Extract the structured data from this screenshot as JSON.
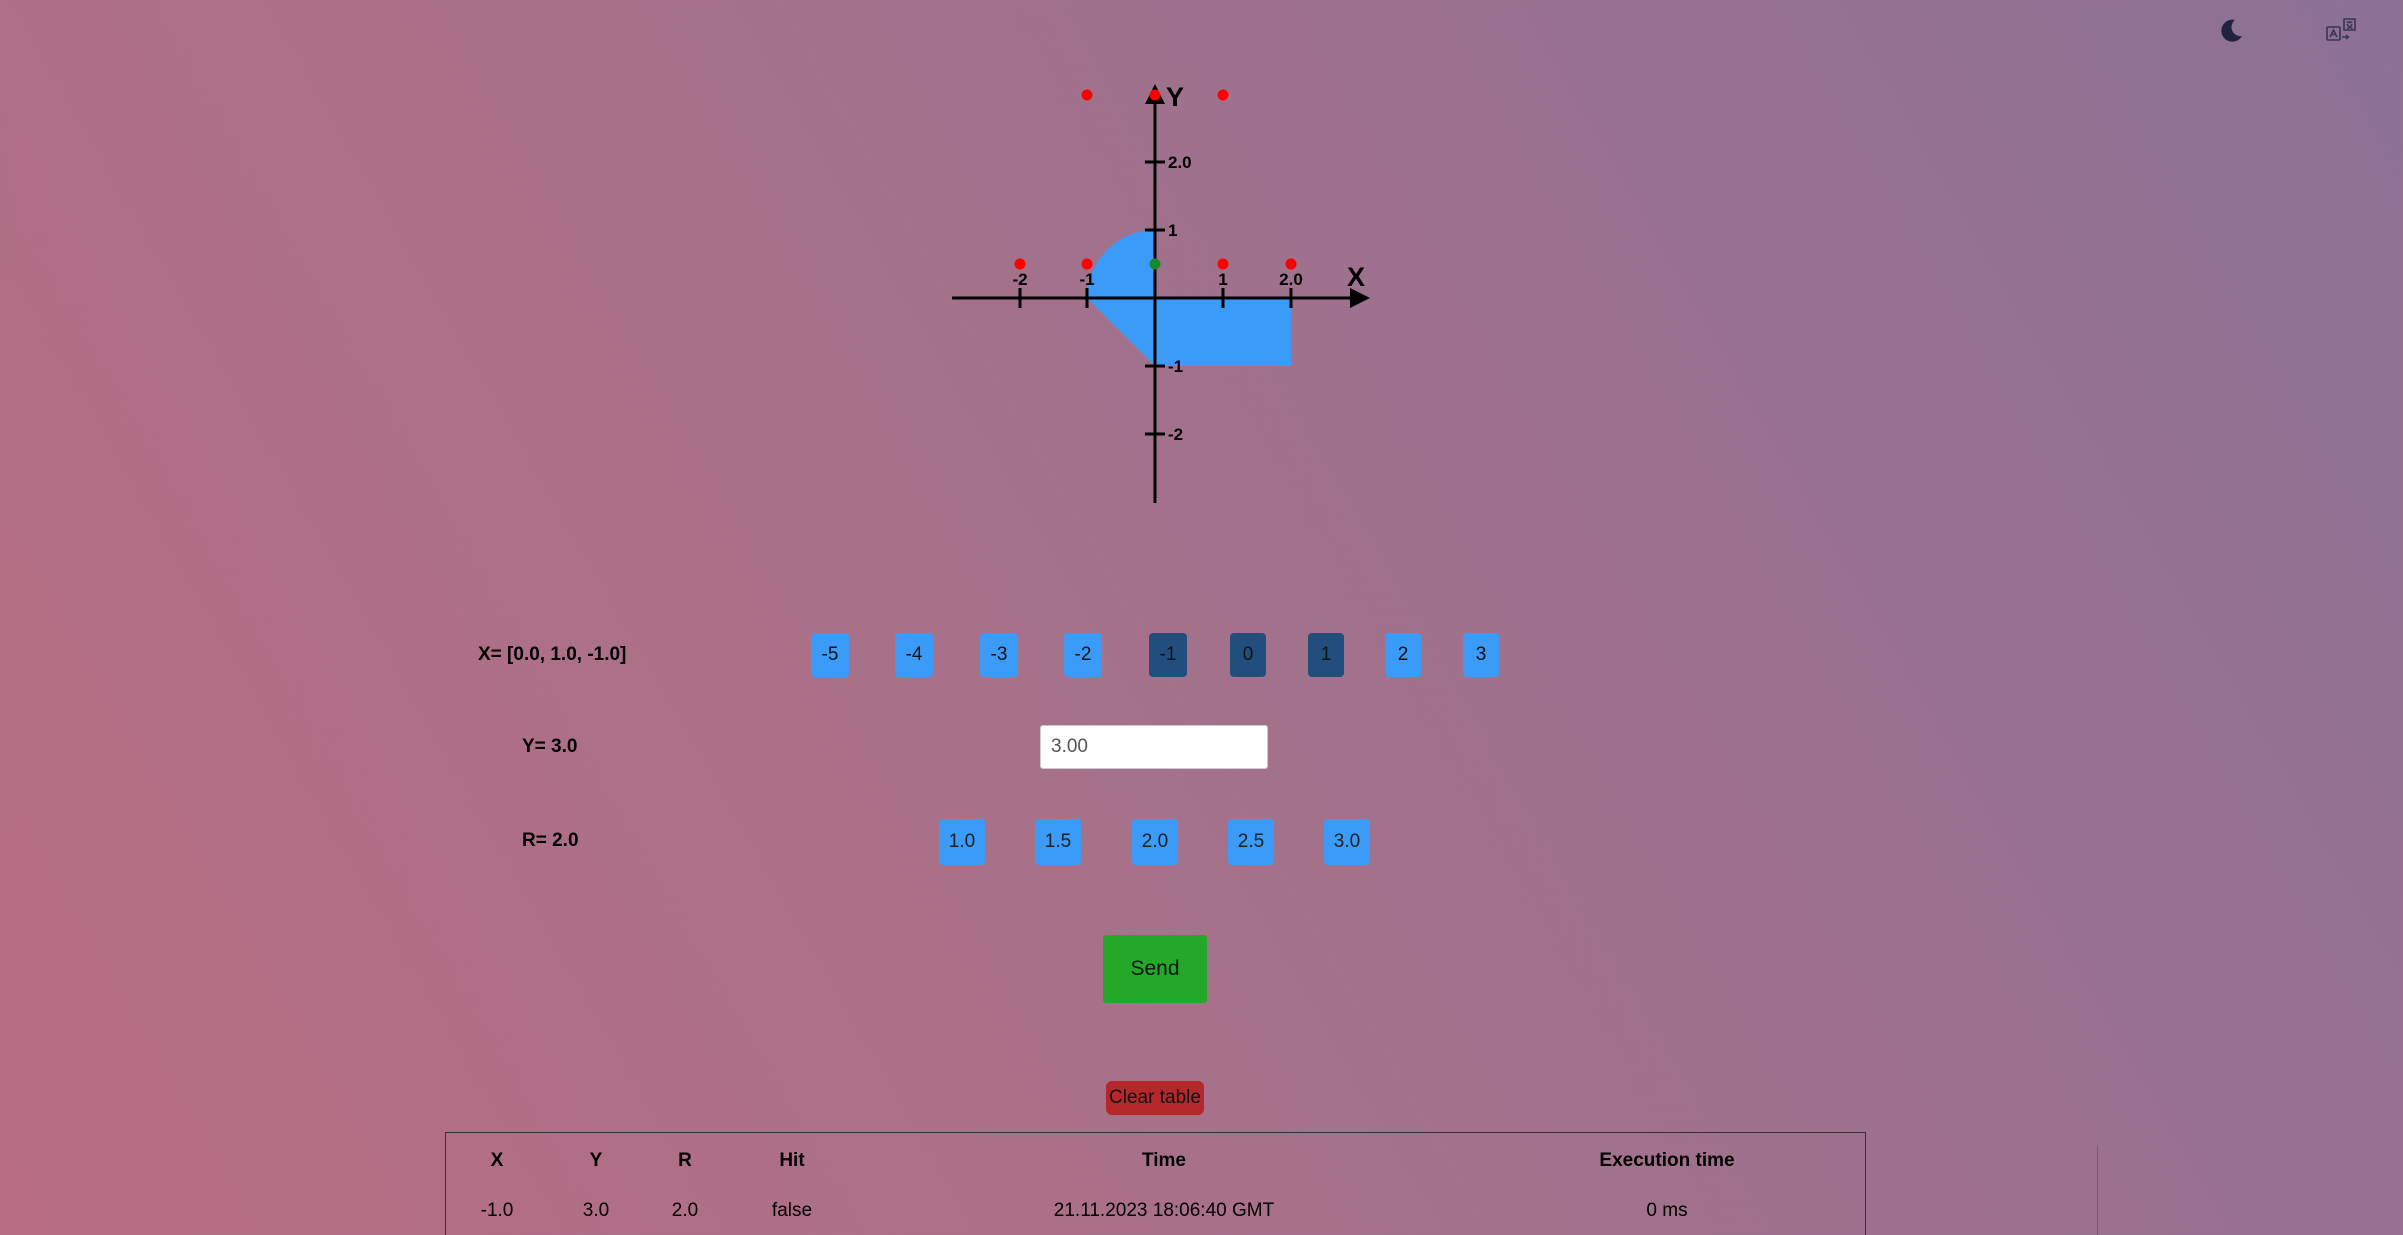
{
  "header": {
    "theme_icon": "moon-icon",
    "language_icon": "translate-icon"
  },
  "graph": {
    "x_axis_label": "X",
    "y_axis_label": "Y",
    "x_ticks": [
      "-2",
      "-1",
      "1",
      "2.0"
    ],
    "y_ticks": [
      "2.0",
      "1",
      "-1",
      "-2"
    ],
    "area_color": "#3a9bf8",
    "miss_color": "#ff0000",
    "hit_color": "#178a2b"
  },
  "form": {
    "x_label": "X= [0.0, 1.0, -1.0]",
    "x_options": [
      "-5",
      "-4",
      "-3",
      "-2",
      "-1",
      "0",
      "1",
      "2",
      "3"
    ],
    "x_selected": [
      "-1",
      "0",
      "1"
    ],
    "y_label": "Y= 3.0",
    "y_value": "3.00",
    "r_label": "R= 2.0",
    "r_options": [
      "1.0",
      "1.5",
      "2.0",
      "2.5",
      "3.0"
    ],
    "send_label": "Send",
    "clear_label": "Clear table"
  },
  "table": {
    "columns": [
      "X",
      "Y",
      "R",
      "Hit",
      "Time",
      "Execution time"
    ],
    "rows": [
      [
        "-1.0",
        "3.0",
        "2.0",
        "false",
        "21.11.2023 18:06:40 GMT",
        "0 ms"
      ]
    ]
  },
  "colors": {
    "button_blue": "#3a9bf8",
    "button_selected": "#224e7e",
    "send_green": "#23a82a",
    "clear_red": "#b4272a"
  }
}
